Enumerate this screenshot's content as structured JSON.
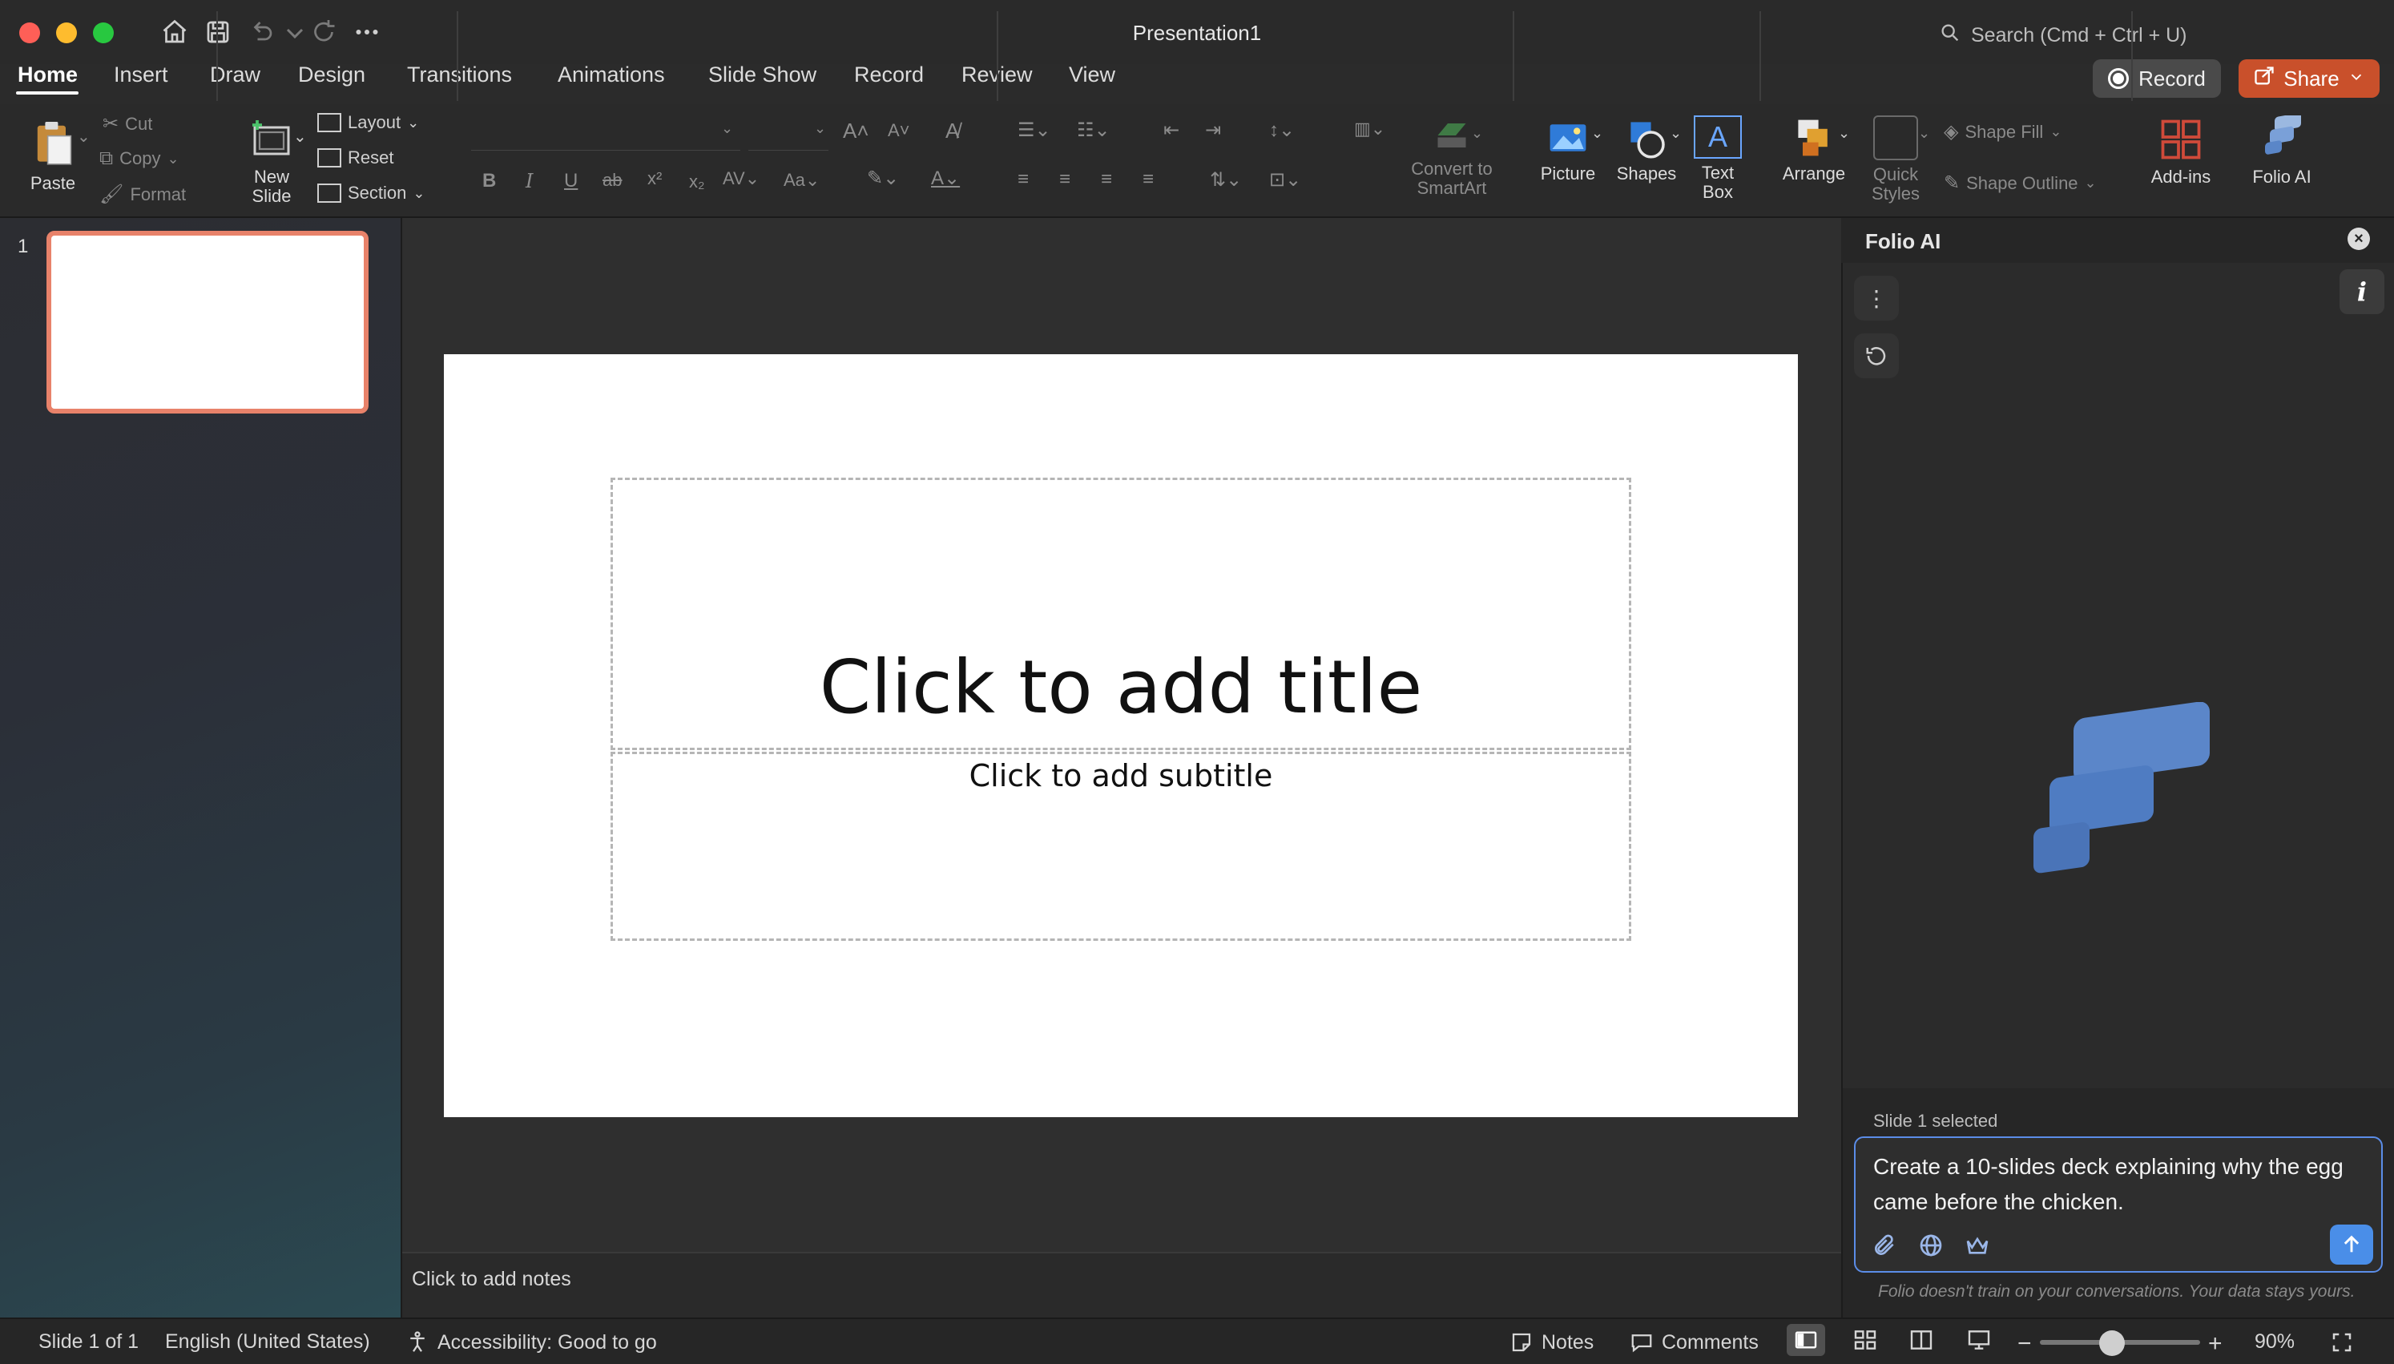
{
  "window": {
    "title": "Presentation1",
    "search_placeholder": "Search (Cmd + Ctrl + U)"
  },
  "tabs": [
    {
      "label": "Home",
      "active": true
    },
    {
      "label": "Insert"
    },
    {
      "label": "Draw"
    },
    {
      "label": "Design"
    },
    {
      "label": "Transitions"
    },
    {
      "label": "Animations"
    },
    {
      "label": "Slide Show"
    },
    {
      "label": "Record"
    },
    {
      "label": "Review"
    },
    {
      "label": "View"
    }
  ],
  "header_buttons": {
    "record": "Record",
    "share": "Share"
  },
  "ribbon": {
    "paste": "Paste",
    "cut": "Cut",
    "copy": "Copy",
    "format": "Format",
    "new_slide_1": "New",
    "new_slide_2": "Slide",
    "layout": "Layout",
    "reset": "Reset",
    "section": "Section",
    "convert_1": "Convert to",
    "convert_2": "SmartArt",
    "picture": "Picture",
    "shapes": "Shapes",
    "textbox_1": "Text",
    "textbox_2": "Box",
    "arrange": "Arrange",
    "quick_styles_1": "Quick",
    "quick_styles_2": "Styles",
    "shape_fill": "Shape Fill",
    "shape_outline": "Shape Outline",
    "addins": "Add-ins",
    "folio_ai": "Folio AI"
  },
  "thumbnails": {
    "slide_number": "1"
  },
  "slide": {
    "title_placeholder": "Click to add title",
    "subtitle_placeholder": "Click to add subtitle"
  },
  "notes": {
    "placeholder": "Click to add notes"
  },
  "folio": {
    "title": "Folio AI",
    "selection_label": "Slide 1 selected",
    "prompt_text": "Create a 10-slides deck explaining why the egg came before the chicken.",
    "disclaimer": "Folio doesn't train on your conversations. Your data stays yours."
  },
  "status": {
    "slide_info": "Slide 1 of 1",
    "language": "English (United States)",
    "accessibility": "Accessibility: Good to go",
    "notes": "Notes",
    "comments": "Comments",
    "zoom": "90%",
    "zoom_level_fraction": 0.45
  },
  "colors": {
    "accent": "#c9502b",
    "selection": "#e8826a",
    "folio_blue": "#4a8ee8"
  }
}
